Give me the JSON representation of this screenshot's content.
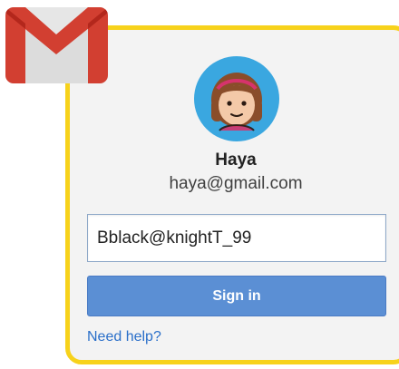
{
  "account": {
    "name": "Haya",
    "email": "haya@gmail.com"
  },
  "password_field": {
    "value": "Bblack@knightT_99"
  },
  "signin_button": {
    "label": "Sign in"
  },
  "help_link": {
    "label": "Need help?"
  },
  "icons": {
    "logo": "gmail-logo-icon",
    "avatar": "user-avatar-icon"
  },
  "colors": {
    "card_border": "#f7d21b",
    "card_background": "#f3f3f3",
    "button": "#5b8fd4",
    "link": "#2a6fc9",
    "avatar_background": "#3aa7e0"
  }
}
